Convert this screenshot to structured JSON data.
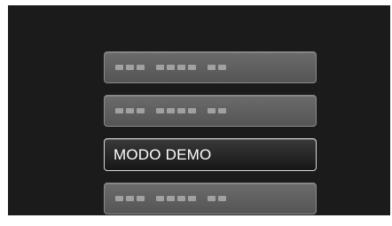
{
  "menu": {
    "items": [
      {
        "label": "",
        "selected": false
      },
      {
        "label": "",
        "selected": false
      },
      {
        "label": "MODO DEMO",
        "selected": true
      },
      {
        "label": "",
        "selected": false
      }
    ]
  },
  "colors": {
    "screen_bg": "#1b1b1b",
    "item_bg": "#5f5f5f",
    "selected_bg": "#2a2a2a",
    "text": "#ffffff"
  }
}
